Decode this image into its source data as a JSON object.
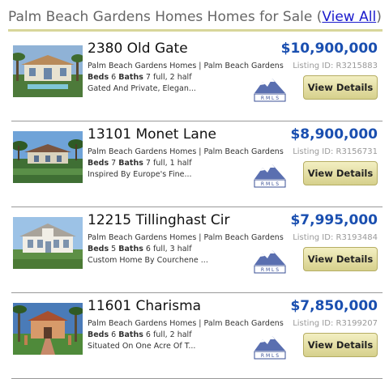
{
  "header": {
    "title": "Palm Beach Gardens Homes Homes for Sale (",
    "link": "View All",
    "close": ")"
  },
  "listings": [
    {
      "address": "2380 Old Gate",
      "area": "Palm Beach Gardens Homes | Palm Beach Gardens",
      "beds_label": "Beds",
      "beds": "6",
      "baths_label": "Baths",
      "baths": "7 full, 2 half",
      "desc": "Gated And Private, Elegan...",
      "price": "$10,900,000",
      "listing_id": "Listing ID: R3215883",
      "button": "View Details",
      "logo": "R M L S"
    },
    {
      "address": "13101 Monet Lane",
      "area": "Palm Beach Gardens Homes | Palm Beach Gardens",
      "beds_label": "Beds",
      "beds": "7",
      "baths_label": "Baths",
      "baths": "7 full, 1 half",
      "desc": "Inspired By Europe's Fine...",
      "price": "$8,900,000",
      "listing_id": "Listing ID: R3156731",
      "button": "View Details",
      "logo": "R M L S"
    },
    {
      "address": "12215 Tillinghast Cir",
      "area": "Palm Beach Gardens Homes | Palm Beach Gardens",
      "beds_label": "Beds",
      "beds": "5",
      "baths_label": "Baths",
      "baths": "6 full, 3 half",
      "desc": "Custom Home By Courchene ...",
      "price": "$7,995,000",
      "listing_id": "Listing ID: R3193484",
      "button": "View Details",
      "logo": "R M L S"
    },
    {
      "address": "11601 Charisma",
      "area": "Palm Beach Gardens Homes | Palm Beach Gardens",
      "beds_label": "Beds",
      "beds": "6",
      "baths_label": "Baths",
      "baths": "6 full, 2 half",
      "desc": "Situated On One Acre Of T...",
      "price": "$7,850,000",
      "listing_id": "Listing ID: R3199207",
      "button": "View Details",
      "logo": "R M L S"
    }
  ]
}
